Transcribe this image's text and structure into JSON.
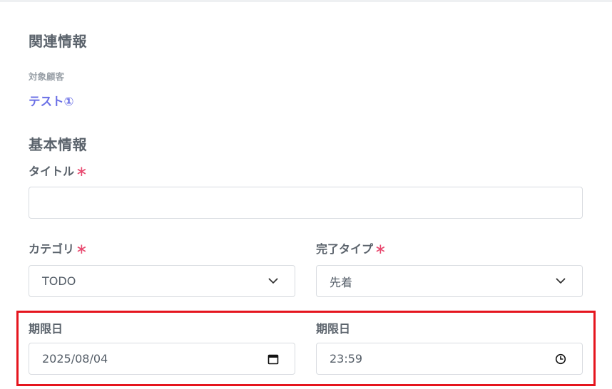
{
  "related": {
    "heading": "関連情報",
    "customer_label": "対象顧客",
    "customer_value": "テスト①"
  },
  "basic": {
    "heading": "基本情報",
    "title_label": "タイトル",
    "title_value": "",
    "category_label": "カテゴリ",
    "category_value": "TODO",
    "completion_label": "完了タイプ",
    "completion_value": "先着",
    "due_date_label": "期限日",
    "due_date_value": "2025/08/04",
    "due_time_label": "期限日",
    "due_time_value": "23:59",
    "required_mark": "∗"
  },
  "colors": {
    "accent_link": "#6a6fe6",
    "required": "#e8496f",
    "highlight": "#e5151e"
  },
  "icons": [
    "chevron-down-icon",
    "calendar-icon",
    "clock-icon"
  ]
}
